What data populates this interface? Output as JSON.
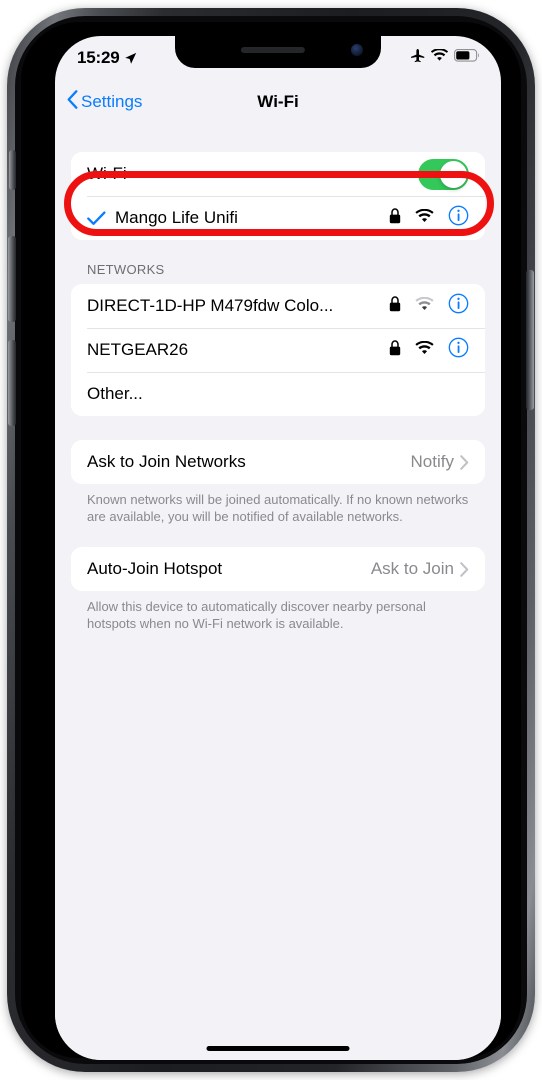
{
  "status_bar": {
    "time": "15:29",
    "location_icon": "location-arrow-icon",
    "airplane_icon": "airplane-mode-icon",
    "wifi_icon": "wifi-icon",
    "battery_icon": "battery-icon",
    "battery_level_percent": 62
  },
  "nav": {
    "back_label": "Settings",
    "title": "Wi-Fi"
  },
  "wifi_toggle_row": {
    "label": "Wi-Fi",
    "state": "on"
  },
  "connected_network": {
    "name": "Mango Life Unifi",
    "checked": true,
    "locked": true,
    "signal": "strong"
  },
  "networks_section": {
    "header": "NETWORKS",
    "items": [
      {
        "name": "DIRECT-1D-HP M479fdw Colo...",
        "locked": true,
        "signal": "weak",
        "has_info": true
      },
      {
        "name": "NETGEAR26",
        "locked": true,
        "signal": "strong",
        "has_info": true
      },
      {
        "name": "Other...",
        "locked": false,
        "signal": "none",
        "has_info": false
      }
    ]
  },
  "ask_to_join": {
    "label": "Ask to Join Networks",
    "value": "Notify",
    "footer": "Known networks will be joined automatically. If no known networks are available, you will be notified of available networks."
  },
  "auto_join_hotspot": {
    "label": "Auto-Join Hotspot",
    "value": "Ask to Join",
    "footer": "Allow this device to automatically discover nearby personal hotspots when no Wi-Fi network is available."
  },
  "annotation": {
    "shape": "red-pill-outline",
    "target": "wifi-toggle-row",
    "color": "#ee1111"
  },
  "colors": {
    "accent_blue": "#0a7cff",
    "toggle_green": "#34c759",
    "background": "#f2f2f7",
    "card": "#ffffff",
    "secondary_text": "#8a8a8e"
  }
}
